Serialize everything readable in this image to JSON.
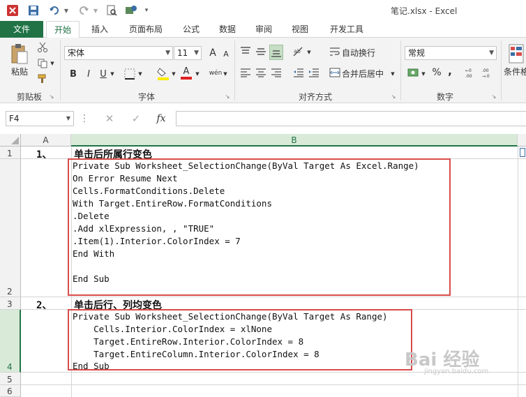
{
  "window": {
    "title": "笔记.xlsx - Excel"
  },
  "quick_access": [
    "excel-logo",
    "save",
    "undo",
    "redo",
    "print-preview",
    "touch-mode",
    "customize"
  ],
  "tabs": [
    {
      "label": "文件",
      "kind": "file"
    },
    {
      "label": "开始",
      "kind": "active"
    },
    {
      "label": "插入"
    },
    {
      "label": "页面布局"
    },
    {
      "label": "公式"
    },
    {
      "label": "数据"
    },
    {
      "label": "审阅"
    },
    {
      "label": "视图"
    },
    {
      "label": "开发工具"
    }
  ],
  "ribbon": {
    "clipboard": {
      "label": "剪贴板",
      "paste_label": "粘贴"
    },
    "font": {
      "label": "字体",
      "font_name": "宋体",
      "font_size": "11",
      "bold": "B",
      "italic": "I",
      "underline": "U",
      "grow": "A",
      "shrink": "A",
      "font_color": "A",
      "phonetic": "wén"
    },
    "alignment": {
      "label": "对齐方式",
      "wrap_text": "自动换行",
      "merge_center": "合并后居中"
    },
    "number": {
      "label": "数字",
      "format": "常规",
      "percent": "%",
      "comma": ","
    },
    "styles": {
      "conditional_label": "条件格"
    }
  },
  "formula_bar": {
    "name_box": "F4",
    "fx": "fx"
  },
  "grid": {
    "columns": [
      "A",
      "B"
    ],
    "rows": [
      "1",
      "2",
      "3",
      "4",
      "5",
      "6"
    ],
    "a1": "1、",
    "b1": "单击后所属行变色",
    "b2_lines": [
      "Private Sub Worksheet_SelectionChange(ByVal Target As Excel.Range)",
      "On Error Resume Next",
      "Cells.FormatConditions.Delete",
      "With Target.EntireRow.FormatConditions",
      ".Delete",
      ".Add xlExpression, , \"TRUE\"",
      ".Item(1).Interior.ColorIndex = 7",
      "End With",
      "",
      "End Sub"
    ],
    "a3": "2、",
    "b3": "单击后行、列均变色",
    "b4_lines": [
      "Private Sub Worksheet_SelectionChange(ByVal Target As Range)",
      "    Cells.Interior.ColorIndex = xlNone",
      "    Target.EntireRow.Interior.ColorIndex = 8",
      "    Target.EntireColumn.Interior.ColorIndex = 8",
      "End Sub"
    ]
  },
  "watermark": {
    "text": "Bai 经验",
    "url": "jingyan.baidu.com"
  },
  "colors": {
    "excel_green": "#217346",
    "highlight_red": "#d94b4b",
    "selected_header": "#d9ead9"
  }
}
